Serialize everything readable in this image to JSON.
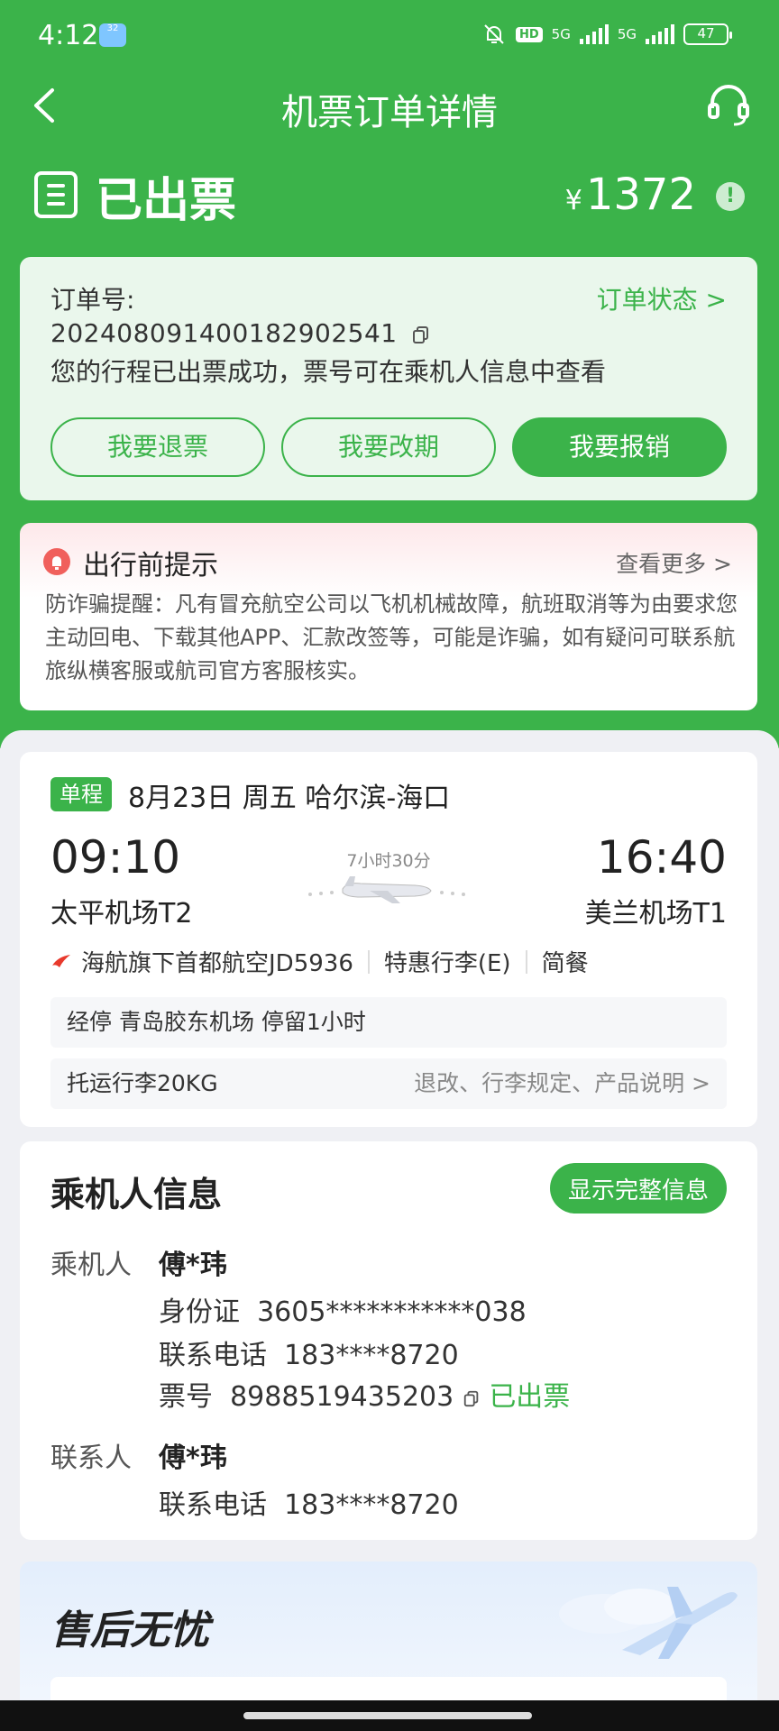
{
  "status_bar": {
    "time": "4:12",
    "weather_badge": "32",
    "hd_label": "HD",
    "network_1": "5G",
    "network_2": "5G",
    "battery": "47"
  },
  "nav": {
    "title": "机票订单详情"
  },
  "order_status": {
    "status_text": "已出票",
    "currency": "¥",
    "price": "1372"
  },
  "order": {
    "label": "订单号:",
    "number": "20240809140018290254​1",
    "status_link": "订单状态 >",
    "message": "您的行程已出票成功，票号可在乘机人信息中查看",
    "buttons": {
      "refund": "我要退票",
      "reschedule": "我要改期",
      "reimburse": "我要报销"
    }
  },
  "tips": {
    "title": "出行前提示",
    "more": "查看更多 >",
    "body": "防诈骗提醒：凡有冒充航空公司以飞机机械故障，航班取消等为由要求您主动回电、下载其他APP、汇款改签等，可能是诈骗，如有疑问可联系航旅纵横客服或航司官方客服核实。"
  },
  "flight": {
    "trip_type": "单程",
    "date": "8月23日 周五 哈尔滨-海口",
    "dep_time": "09:10",
    "arr_time": "16:40",
    "duration": "7小时30分",
    "dep_airport": "太平机场T2",
    "arr_airport": "美兰机场T1",
    "airline": "海航旗下首都航空JD5936",
    "fare": "特惠行李(E)",
    "meal": "简餐",
    "stopover": "经停  青岛胶东机场 停留1小时",
    "baggage": "托运行李20KG",
    "rules_link": "退改、行李规定、产品说明 >"
  },
  "passenger": {
    "title": "乘机人信息",
    "show_full": "显示完整信息",
    "pax_label": "乘机人",
    "pax_name": "傅*玮",
    "id_label": "身份证",
    "id_value": "3605***********038",
    "phone_label": "联系电话",
    "phone_value": "183****8720",
    "ticket_label": "票号",
    "ticket_value": "8988519435203",
    "ticket_status": "已出票",
    "contact_label": "联系人",
    "contact_name": "傅*玮",
    "contact_phone_label": "联系电话",
    "contact_phone_value": "183****8720"
  },
  "aftersale": {
    "title": "售后无忧"
  },
  "colors": {
    "brand_green": "#3bb34a",
    "alert_red": "#f0605c"
  }
}
